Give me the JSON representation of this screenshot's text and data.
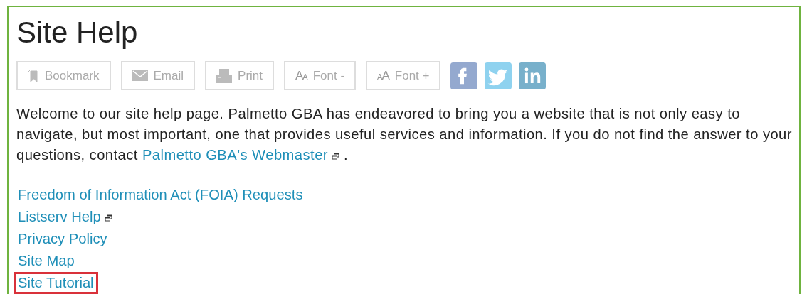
{
  "title": "Site Help",
  "toolbar": [
    {
      "kind": "bookmark",
      "label": "Bookmark"
    },
    {
      "kind": "email",
      "label": "Email"
    },
    {
      "kind": "print",
      "label": "Print"
    },
    {
      "kind": "font-decrease",
      "label": "Font -",
      "icon_text": [
        "A",
        "A"
      ]
    },
    {
      "kind": "font-increase",
      "label": "Font +",
      "icon_text": [
        "A",
        "A"
      ]
    }
  ],
  "social": [
    {
      "kind": "facebook"
    },
    {
      "kind": "twitter"
    },
    {
      "kind": "linkedin"
    }
  ],
  "intro": {
    "text": "Welcome to our site help page. Palmetto GBA has endeavored to bring you a website that is not only easy to navigate, but most important, one that provides useful services and information.  If you do not find the answer to your questions, contact",
    "link": {
      "label": "Palmetto GBA's Webmaster",
      "external": true
    },
    "text_after": "."
  },
  "links": [
    {
      "label": "Freedom of Information Act (FOIA) Requests",
      "external": false,
      "highlighted": false
    },
    {
      "label": "Listserv Help",
      "external": true,
      "highlighted": false
    },
    {
      "label": "Privacy Policy",
      "external": false,
      "highlighted": false
    },
    {
      "label": "Site Map",
      "external": false,
      "highlighted": false
    },
    {
      "label": "Site Tutorial",
      "external": false,
      "highlighted": true
    }
  ]
}
